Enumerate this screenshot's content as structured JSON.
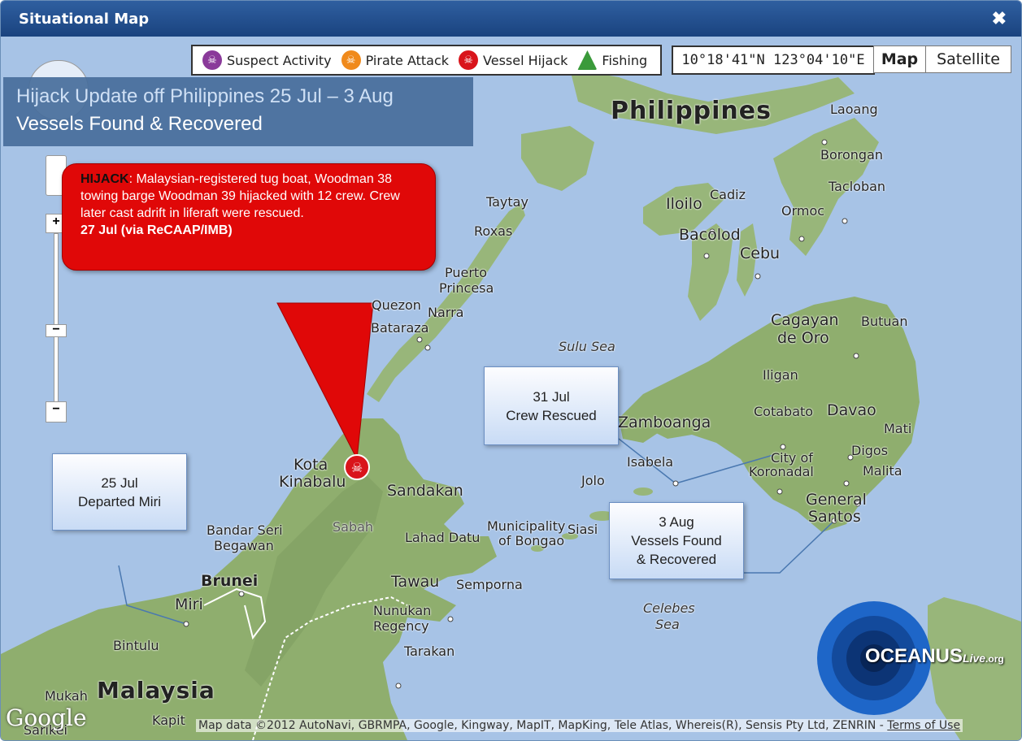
{
  "window": {
    "title": "Situational Map",
    "close_glyph": "✖"
  },
  "legend": [
    {
      "label": "Suspect Activity",
      "color": "#8a3a9a",
      "icon": "skull-icon"
    },
    {
      "label": "Pirate Attack",
      "color": "#f08a1c",
      "icon": "skull-icon"
    },
    {
      "label": "Vessel Hijack",
      "color": "#d9141b",
      "icon": "skull-icon"
    },
    {
      "label": "Fishing",
      "color": "#3a9a3a",
      "icon": "fish-icon"
    }
  ],
  "coords": "10°18'41\"N  123°04'10\"E",
  "map_buttons": {
    "map": "Map",
    "satellite": "Satellite"
  },
  "headline": {
    "line1": "Hijack  Update off Philippines 25 Jul – 3 Aug",
    "line2": "Vessels Found & Recovered"
  },
  "callout": {
    "label": "HIJACK",
    "text": ": Malaysian-registered tug boat, Woodman 38 towing barge Woodman 39 hijacked with 12 crew. Crew later cast adrift in liferaft were rescued.",
    "source": "27 Jul (via ReCAAP/IMB)"
  },
  "notes": {
    "miri": [
      "25 Jul",
      "Departed Miri"
    ],
    "rescued": [
      "31 Jul",
      "Crew Rescued"
    ],
    "recovered": [
      "3 Aug",
      "Vessels Found",
      "& Recovered"
    ]
  },
  "places": {
    "philippines": "Philippines",
    "malaysia": "Malaysia",
    "laoang": "Laoang",
    "borongan": "Borongan",
    "tacloban": "Tacloban",
    "iloilo": "Iloilo",
    "cadiz": "Cadiz",
    "ormoc": "Ormoc",
    "bacolod": "Bacolod",
    "cebu": "Cebu",
    "taytay": "Taytay",
    "roxas": "Roxas",
    "puerto": "Puerto",
    "princesa": "Princesa",
    "quezon": "Quezon",
    "narra": "Narra",
    "bataraza": "Bataraza",
    "sulu_sea": "Sulu Sea",
    "cagayan": "Cagayan",
    "de_oro": "de Oro",
    "butuan": "Butuan",
    "iligan": "Iligan",
    "zamboanga": "Zamboanga",
    "cotabato": "Cotabato",
    "davao": "Davao",
    "mati": "Mati",
    "digos": "Digos",
    "malita": "Malita",
    "city_of": "City of",
    "koronadal": "Koronadal",
    "general": "General",
    "santos": "Santos",
    "isabela": "Isabela",
    "jolo": "Jolo",
    "siasi": "Siasi",
    "kota": "Kota",
    "kinabalu": "Kinabalu",
    "sandakan": "Sandakan",
    "sabah": "Sabah",
    "lahad_datu": "Lahad Datu",
    "municipality": "Municipality",
    "of_bongao": "of Bongao",
    "bandar_seri": "Bandar Seri",
    "begawan": "Begawan",
    "brunei": "Brunei",
    "miri": "Miri",
    "tawau": "Tawau",
    "semporna": "Semporna",
    "nunukan": "Nunukan",
    "regency": "Regency",
    "tarakan": "Tarakan",
    "celebes": "Celebes",
    "sea": "Sea",
    "bintulu": "Bintulu",
    "mukah": "Mukah",
    "kapit": "Kapit",
    "sarikei": "Sarikei"
  },
  "attribution": "Map data ©2012 AutoNavi, GBRMPA, Google, Kingway, MapIT, MapKing, Tele Atlas, Whereis(R), Sensis Pty Ltd, ZENRIN -",
  "terms": "Terms of Use",
  "google_logo": "Google",
  "brand": {
    "oceanus": "OCEANUS",
    "live": "Live",
    "org": ".org"
  }
}
